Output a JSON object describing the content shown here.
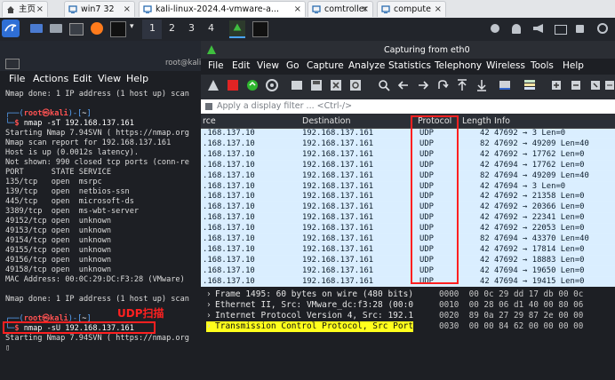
{
  "tabs": [
    {
      "label": "主页",
      "icon": "home-icon"
    },
    {
      "label": "win7 32",
      "icon": "vm-icon"
    },
    {
      "label": "kali-linux-2024.4-vmware-a...",
      "icon": "vm-icon"
    },
    {
      "label": "comtroller",
      "icon": "vm-icon"
    },
    {
      "label": "compute",
      "icon": "vm-icon"
    }
  ],
  "panel": {
    "workspaces": [
      "1",
      "2",
      "3",
      "4"
    ]
  },
  "terminal": {
    "title": "root@kali",
    "menu": [
      "File",
      "Actions",
      "Edit",
      "View",
      "Help"
    ],
    "lines": [
      "Nmap done: 1 IP address (1 host up) scan",
      "",
      "",
      "Starting Nmap 7.94SVN ( https://nmap.org",
      "Nmap scan report for 192.168.137.161",
      "Host is up (0.0012s latency).",
      "Not shown: 990 closed tcp ports (conn-re",
      "PORT      STATE SERVICE",
      "135/tcp   open  msrpc",
      "139/tcp   open  netbios-ssn",
      "445/tcp   open  microsoft-ds",
      "3389/tcp  open  ms-wbt-server",
      "49152/tcp open  unknown",
      "49153/tcp open  unknown",
      "49154/tcp open  unknown",
      "49155/tcp open  unknown",
      "49156/tcp open  unknown",
      "49158/tcp open  unknown",
      "MAC Address: 00:0C:29:DC:F3:28 (VMware)",
      "",
      "Nmap done: 1 IP address (1 host up) scan",
      "",
      "",
      "Starting Nmap 7.94SVN ( https://nmap.org"
    ],
    "prompt1": {
      "user": "root",
      "host": "kali",
      "dir": "~",
      "cmd": "nmap -sT 192.168.137.161"
    },
    "prompt2": {
      "user": "root",
      "host": "kali",
      "dir": "~",
      "cmd": "nmap -sU 192.168.137.161"
    }
  },
  "annotation": {
    "udp_scan_label": "UDP扫描"
  },
  "wireshark": {
    "title": "Capturing from eth0",
    "menu": [
      "File",
      "Edit",
      "View",
      "Go",
      "Capture",
      "Analyze",
      "Statistics",
      "Telephony",
      "Wireless",
      "Tools",
      "Help"
    ],
    "filter_placeholder": "Apply a display filter ... <Ctrl-/>",
    "columns": {
      "source": "rce",
      "destination": "Destination",
      "protocol": "Protocol",
      "length": "Length",
      "info": "Info"
    },
    "rows": [
      {
        "source": ".168.137.10",
        "destination": "192.168.137.161",
        "protocol": "UDP",
        "length": "42",
        "info": "47692 → 3 Len=0"
      },
      {
        "source": ".168.137.10",
        "destination": "192.168.137.161",
        "protocol": "UDP",
        "length": "82",
        "info": "47692 → 49209 Len=40"
      },
      {
        "source": ".168.137.10",
        "destination": "192.168.137.161",
        "protocol": "UDP",
        "length": "42",
        "info": "47692 → 17762 Len=0"
      },
      {
        "source": ".168.137.10",
        "destination": "192.168.137.161",
        "protocol": "UDP",
        "length": "42",
        "info": "47694 → 17762 Len=0"
      },
      {
        "source": ".168.137.10",
        "destination": "192.168.137.161",
        "protocol": "UDP",
        "length": "82",
        "info": "47694 → 49209 Len=40"
      },
      {
        "source": ".168.137.10",
        "destination": "192.168.137.161",
        "protocol": "UDP",
        "length": "42",
        "info": "47694 → 3 Len=0"
      },
      {
        "source": ".168.137.10",
        "destination": "192.168.137.161",
        "protocol": "UDP",
        "length": "42",
        "info": "47692 → 21358 Len=0"
      },
      {
        "source": ".168.137.10",
        "destination": "192.168.137.161",
        "protocol": "UDP",
        "length": "42",
        "info": "47692 → 20366 Len=0"
      },
      {
        "source": ".168.137.10",
        "destination": "192.168.137.161",
        "protocol": "UDP",
        "length": "42",
        "info": "47692 → 22341 Len=0"
      },
      {
        "source": ".168.137.10",
        "destination": "192.168.137.161",
        "protocol": "UDP",
        "length": "42",
        "info": "47692 → 22053 Len=0"
      },
      {
        "source": ".168.137.10",
        "destination": "192.168.137.161",
        "protocol": "UDP",
        "length": "82",
        "info": "47694 → 43370 Len=40"
      },
      {
        "source": ".168.137.10",
        "destination": "192.168.137.161",
        "protocol": "UDP",
        "length": "42",
        "info": "47692 → 17814 Len=0"
      },
      {
        "source": ".168.137.10",
        "destination": "192.168.137.161",
        "protocol": "UDP",
        "length": "42",
        "info": "47692 → 18883 Len=0"
      },
      {
        "source": ".168.137.10",
        "destination": "192.168.137.161",
        "protocol": "UDP",
        "length": "42",
        "info": "47694 → 19650 Len=0"
      },
      {
        "source": ".168.137.10",
        "destination": "192.168.137.161",
        "protocol": "UDP",
        "length": "42",
        "info": "47694 → 19415 Len=0"
      }
    ],
    "details": [
      "Frame 1495: 60 bytes on wire (480 bits)",
      "Ethernet II, Src: VMware_dc:f3:28 (00:0",
      "Internet Protocol Version 4, Src: 192.1",
      "Transmission Control Protocol, Src Port"
    ],
    "bytes": [
      {
        "offset": "0000",
        "hex": "00 0c 29 dd 17 db 00 0c"
      },
      {
        "offset": "0010",
        "hex": "00 28 06 d1 40 00 80 06"
      },
      {
        "offset": "0020",
        "hex": "89 0a 27 29 87 2e 00 00"
      },
      {
        "offset": "0030",
        "hex": "00 00 84 62 00 00 00 00"
      }
    ]
  }
}
